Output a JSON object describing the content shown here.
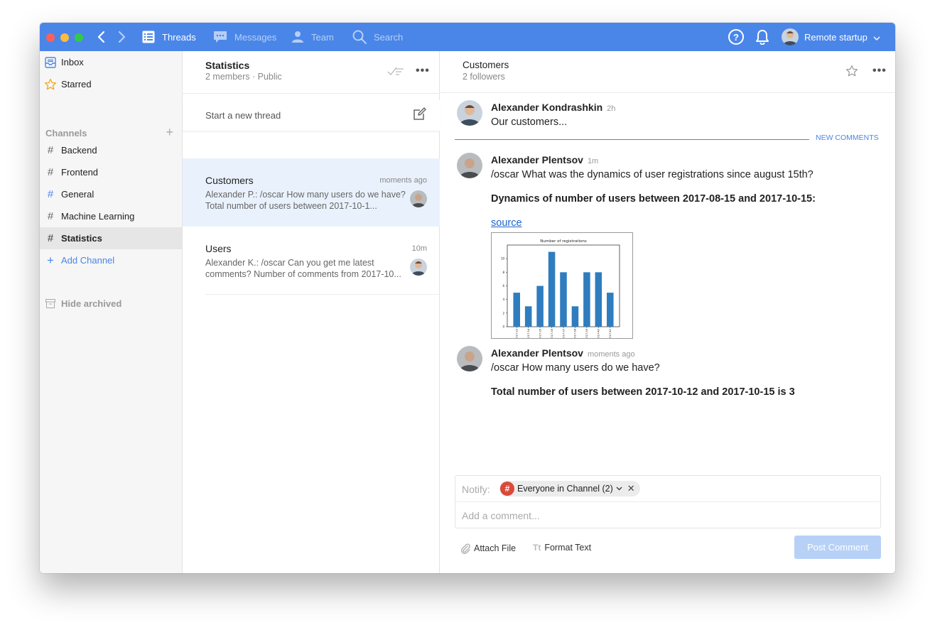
{
  "topbar": {
    "threads_label": "Threads",
    "messages_label": "Messages",
    "team_label": "Team",
    "search_label": "Search",
    "help_label": "?",
    "workspace_name": "Remote startup"
  },
  "sidebar": {
    "inbox_label": "Inbox",
    "starred_label": "Starred",
    "channels_heading": "Channels",
    "channels": [
      {
        "label": "Backend"
      },
      {
        "label": "Frontend"
      },
      {
        "label": "General"
      },
      {
        "label": "Machine Learning"
      },
      {
        "label": "Statistics"
      }
    ],
    "add_channel_label": "Add Channel",
    "hide_archived_label": "Hide archived"
  },
  "threads_panel": {
    "title": "Statistics",
    "subtitle": "2 members · Public",
    "new_thread_label": "Start a new thread",
    "items": [
      {
        "title": "Customers",
        "time": "moments ago",
        "snippet": "Alexander P.: /oscar How many users do we have?  Total number of users between 2017-10-1..."
      },
      {
        "title": "Users",
        "time": "10m",
        "snippet": "Alexander K.: /oscar Can you get me latest comments?  Number of comments from 2017-10..."
      }
    ]
  },
  "conversation": {
    "title": "Customers",
    "subtitle": "2 followers",
    "new_comments_label": "NEW COMMENTS",
    "messages": [
      {
        "author": "Alexander Kondrashkin",
        "time": "2h",
        "text": "Our customers..."
      },
      {
        "author": "Alexander Plentsov",
        "time": "1m",
        "text": "/oscar What was the dynamics of user registrations since august 15th?",
        "bold": "Dynamics of number of users between 2017-08-15 and 2017-10-15:",
        "link": "source"
      },
      {
        "author": "Alexander Plentsov",
        "time": "moments ago",
        "text": "/oscar How many users do we have?",
        "bold": "Total number of users between 2017-10-12 and 2017-10-15 is 3"
      }
    ]
  },
  "composer": {
    "notify_label": "Notify:",
    "notify_chip": "Everyone in Channel (2)",
    "comment_placeholder": "Add a comment...",
    "attach_label": "Attach File",
    "format_icon_text": "Tt",
    "format_label": "Format Text",
    "post_label": "Post Comment"
  },
  "colors": {
    "accent": "#4a86e8",
    "link": "#1a66cc",
    "bar": "#2f7dbf",
    "chip_hash": "#d94a3a"
  },
  "chart_data": {
    "type": "bar",
    "title": "Number of registrations",
    "categories": [
      "2017-33",
      "2017-34",
      "2017-35",
      "2017-36",
      "2017-37",
      "2017-38",
      "2017-39",
      "2017-40",
      "2017-41"
    ],
    "values": [
      5,
      3,
      6,
      11,
      8,
      3,
      8,
      8,
      5
    ],
    "yticks": [
      "0",
      "2",
      "4",
      "6",
      "8",
      "10"
    ],
    "ylim": [
      0,
      12
    ],
    "grid": false
  }
}
